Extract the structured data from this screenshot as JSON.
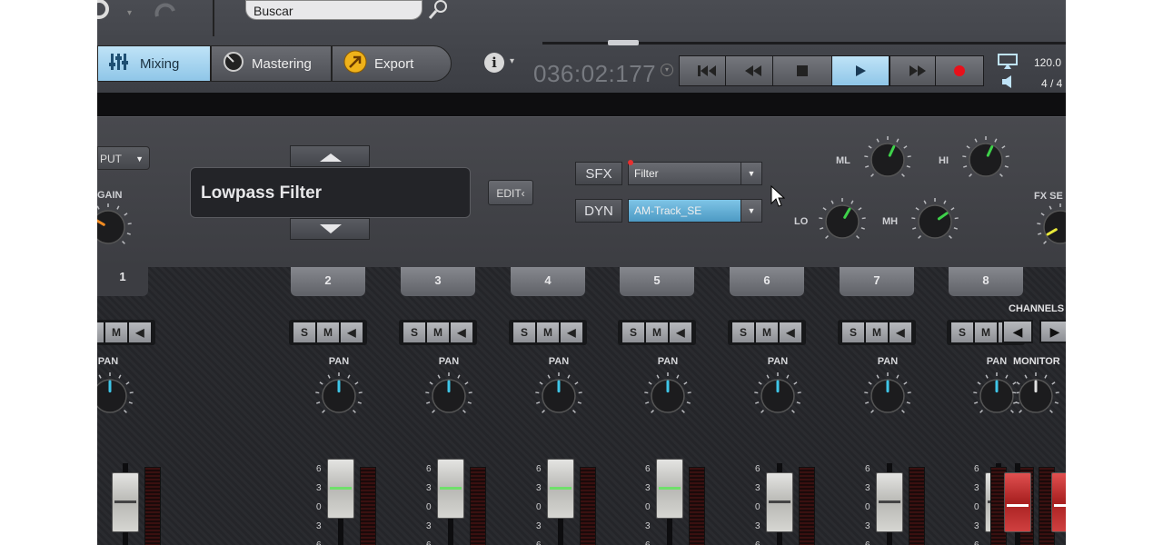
{
  "search": {
    "value": "Buscar"
  },
  "tabs": [
    {
      "label": "Mixing",
      "icon": "mixer-icon",
      "active": true
    },
    {
      "label": "Mastering",
      "icon": "mastering-knob-icon",
      "active": false
    },
    {
      "label": "Export",
      "icon": "export-icon",
      "active": false
    }
  ],
  "transport": {
    "time": "036:02:177",
    "tempo": "120.0",
    "signature": "4 / 4",
    "buttons": [
      "skip-back",
      "rewind",
      "stop",
      "play",
      "fast-forward",
      "record"
    ],
    "active": "play",
    "record_color": "#e8101a"
  },
  "fx_panel": {
    "input_label": "PUT",
    "gain_label": "GAIN",
    "preset_name": "Lowpass Filter",
    "edit_label": "EDIT",
    "sfx_label": "SFX",
    "dyn_label": "DYN",
    "sfx_select": "Filter",
    "dyn_select": "AM-Track_SE",
    "eq": {
      "lo": "LO",
      "ml": "ML",
      "mh": "MH",
      "hi": "HI"
    },
    "fx_send_label": "FX SE",
    "eq_indicator_color": "#3ed14a",
    "gain_indicator_color": "#f08a22",
    "fx_indicator_color": "#e8e83a"
  },
  "channels": {
    "numbers": [
      "1",
      "2",
      "3",
      "4",
      "5",
      "6",
      "7",
      "8"
    ],
    "selected": "1",
    "solo_label": "S",
    "mute_label": "M",
    "pan_label": "PAN",
    "scale": [
      "6",
      "3",
      "0",
      "3",
      "6"
    ],
    "pan_indicator_color": "#3fc6e8",
    "fader_levels": [
      {
        "channel": "1",
        "style": "gray"
      },
      {
        "channel": "2",
        "style": "green"
      },
      {
        "channel": "3",
        "style": "green"
      },
      {
        "channel": "4",
        "style": "green"
      },
      {
        "channel": "5",
        "style": "green"
      },
      {
        "channel": "6",
        "style": "gray"
      },
      {
        "channel": "7",
        "style": "gray"
      },
      {
        "channel": "8",
        "style": "gray"
      }
    ]
  },
  "right_section": {
    "channels_label": "CHANNELS",
    "monitor_label": "MONITOR"
  }
}
